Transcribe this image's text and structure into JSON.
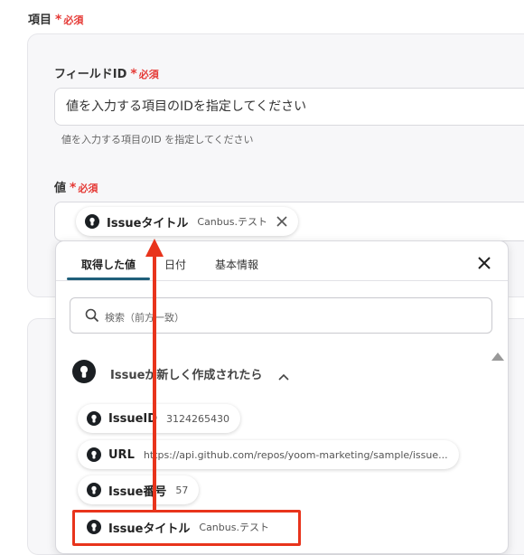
{
  "field_group": {
    "label": "項目",
    "required_star": "*",
    "required_text": "必須"
  },
  "field_id": {
    "label": "フィールドID",
    "required_star": "*",
    "required_text": "必須",
    "placeholder": "値を入力する項目のIDを指定してください",
    "hint": "値を入力する項目のID を指定してください"
  },
  "value": {
    "label": "値",
    "required_star": "*",
    "required_text": "必須",
    "chip": {
      "title": "Issueタイトル",
      "sub": "Canbus.テスト"
    }
  },
  "panel": {
    "tabs": [
      {
        "label": "取得した値",
        "active": true
      },
      {
        "label": "日付",
        "active": false
      },
      {
        "label": "基本情報",
        "active": false
      }
    ],
    "search_placeholder": "検索（前方一致）",
    "group_title": "Issueが新しく作成されたら",
    "items": [
      {
        "title": "IssueID",
        "sub": "3124265430"
      },
      {
        "title": "URL",
        "sub": "https://api.github.com/repos/yoom-marketing/sample/issue..."
      },
      {
        "title": "Issue番号",
        "sub": "57"
      },
      {
        "title": "Issueタイトル",
        "sub": "Canbus.テスト"
      }
    ]
  },
  "colors": {
    "required": "#e53935",
    "highlight": "#e8341c",
    "tab_active": "#1f5f7a"
  },
  "icons": {
    "github": "github-icon",
    "close": "close-icon",
    "search": "search-icon",
    "collapse": "chevron-up-icon"
  }
}
